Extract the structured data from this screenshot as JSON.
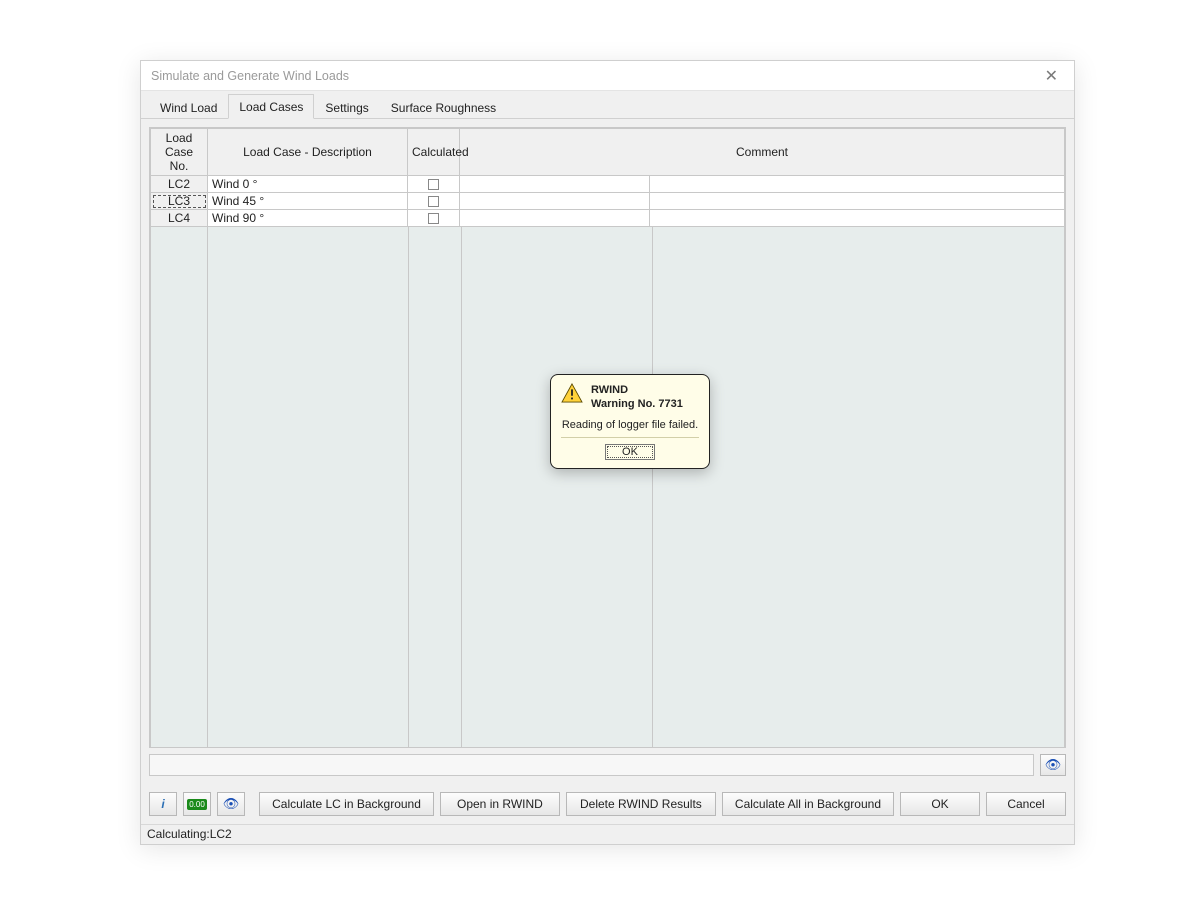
{
  "window": {
    "title": "Simulate and Generate Wind Loads"
  },
  "tabs": {
    "items": [
      {
        "label": "Wind Load"
      },
      {
        "label": "Load Cases"
      },
      {
        "label": "Settings"
      },
      {
        "label": "Surface Roughness"
      }
    ],
    "active_index": 1
  },
  "grid": {
    "headers": {
      "no_line1": "Load Case",
      "no_line2": "No.",
      "desc": "Load Case - Description",
      "calc": "Calculated",
      "comment": "Comment"
    },
    "col_widths": {
      "no": 57,
      "desc": 200,
      "calc": 52
    },
    "rows": [
      {
        "no": "LC2",
        "desc": "Wind 0 °",
        "calculated": false,
        "comment": "",
        "selected": false
      },
      {
        "no": "LC3",
        "desc": "Wind 45 °",
        "calculated": false,
        "comment": "",
        "selected": true
      },
      {
        "no": "LC4",
        "desc": "Wind 90 °",
        "calculated": false,
        "comment": "",
        "selected": false
      }
    ]
  },
  "buttons": {
    "calc_bg": "Calculate LC in Background",
    "open_rwind": "Open in RWIND",
    "delete_results": "Delete RWIND Results",
    "calc_all_bg": "Calculate All in Background",
    "ok": "OK",
    "cancel": "Cancel"
  },
  "icons": {
    "help": "help-icon",
    "calc": "calc-icon",
    "eye": "eye-icon"
  },
  "status": {
    "text": "Calculating:LC2"
  },
  "dialog": {
    "title1": "RWIND",
    "title2": "Warning No. 7731",
    "message": "Reading of logger file failed.",
    "ok": "OK"
  }
}
